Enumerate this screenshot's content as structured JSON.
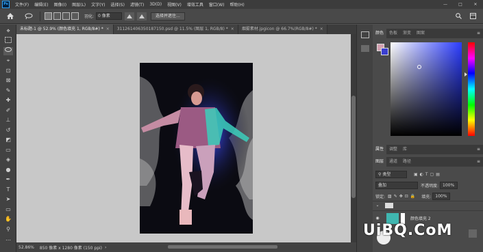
{
  "app": {
    "logo": "Ps"
  },
  "menubar": {
    "items": [
      "文件(F)",
      "编辑(E)",
      "图像(I)",
      "图层(L)",
      "文字(Y)",
      "选择(S)",
      "滤镜(T)",
      "3D(D)",
      "视图(V)",
      "增效工具",
      "窗口(W)",
      "帮助(H)"
    ],
    "window_controls": [
      "—",
      "□",
      "✕"
    ]
  },
  "options": {
    "feather_label": "羽化:",
    "feather_value": "0 像素",
    "select_subject_label": "选择并遮住..."
  },
  "tabs": [
    {
      "label": "未标题-1 @ 52.9% (颜色填充 1, RGB/8#) *",
      "active": true
    },
    {
      "label": "31126140635018715​0.psd @ 11.5% (图层 1, RGB/8) *",
      "active": false
    },
    {
      "label": "烟雾素材.jpgicon @ 66.7%(RGB/8#) *",
      "active": false
    }
  ],
  "status": {
    "zoom": "52.86%",
    "doc_info": "850 像素 x 1280 像素 (150 ppi)"
  },
  "color_panel": {
    "tabs": [
      "颜色",
      "色板",
      "渐变",
      "图案"
    ],
    "accent": "#2b3cff"
  },
  "props_panel": {
    "tabs": [
      "属性",
      "调整",
      "库"
    ]
  },
  "layers_panel": {
    "tabs": [
      "图层",
      "通道",
      "路径"
    ],
    "filter_label": "类型",
    "blend_mode": "叠加",
    "opacity_label": "不透明度:",
    "opacity_value": "100%",
    "lock_label": "锁定:",
    "fill_label": "填充:",
    "fill_value": "100%",
    "layers": [
      {
        "name": "颜色填充 2",
        "color": "#3fb6b0"
      }
    ]
  },
  "watermark": {
    "text": "UiBQ.CoM"
  }
}
